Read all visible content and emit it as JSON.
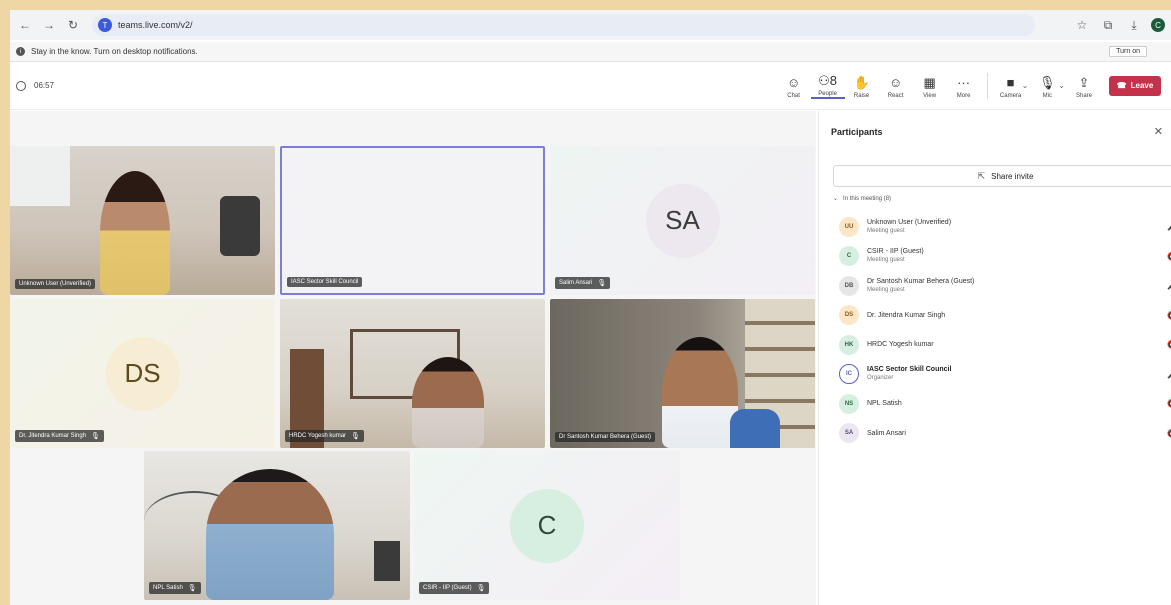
{
  "browser": {
    "url": "teams.live.com/v2/",
    "site_icon": "T",
    "profile": "C",
    "icons": [
      "back-icon",
      "forward-icon",
      "reload-icon",
      "star-icon",
      "extensions-icon",
      "download-icon"
    ]
  },
  "notification": {
    "text": "Stay in the know. Turn on desktop notifications.",
    "button": "Turn on"
  },
  "toolbar": {
    "timer": "06:57",
    "tools": [
      {
        "label": "Chat",
        "icon": "chat-icon",
        "glyph": "☺"
      },
      {
        "label": "People",
        "icon": "people-icon",
        "glyph": "⚇",
        "badge": "8"
      },
      {
        "label": "Raise",
        "icon": "raise-hand-icon",
        "glyph": "✋"
      },
      {
        "label": "React",
        "icon": "react-icon",
        "glyph": "☺"
      },
      {
        "label": "View",
        "icon": "view-icon",
        "glyph": "▦"
      },
      {
        "label": "More",
        "icon": "more-icon",
        "glyph": "···"
      },
      {
        "label": "Camera",
        "icon": "camera-icon",
        "glyph": "■"
      },
      {
        "label": "Mic",
        "icon": "mic-icon",
        "glyph": "🎙"
      },
      {
        "label": "Share",
        "icon": "share-icon",
        "glyph": "⇪"
      }
    ],
    "leave": "Leave"
  },
  "tiles": [
    {
      "name": "Unknown User (Unverified)",
      "type": "video",
      "muted": false
    },
    {
      "name": "IASC Sector Skill Council",
      "type": "blank",
      "muted": false
    },
    {
      "name": "Salim Ansari",
      "type": "avatar",
      "initials": "SA",
      "avatar_bg": "#ede7f0",
      "avatar_fg": "#3b3b3b",
      "muted": true
    },
    {
      "name": "Dr. Jitendra Kumar Singh",
      "type": "avatar",
      "initials": "DS",
      "avatar_bg": "#f7ecd4",
      "avatar_fg": "#5e4a1c",
      "muted": true
    },
    {
      "name": "HRDC Yogesh kumar",
      "type": "video",
      "muted": true
    },
    {
      "name": "Dr Santosh Kumar Behera (Guest)",
      "type": "video",
      "muted": false
    },
    {
      "name": "NPL Satish",
      "type": "video",
      "muted": true
    },
    {
      "name": "CSIR - IIP (Guest)",
      "type": "avatar",
      "initials": "C",
      "avatar_bg": "#d6efe0",
      "avatar_fg": "#2f4a3a",
      "muted": true
    }
  ],
  "panel": {
    "title": "Participants",
    "share_invite": "Share invite",
    "section": "In this meeting (8)",
    "participants": [
      {
        "initials": "UU",
        "name": "Unknown User (Unverified)",
        "role": "Meeting guest",
        "bg": "#fbe6c8",
        "fg": "#8a5a18",
        "mic": "🎤",
        "bold": false,
        "organizer": false
      },
      {
        "initials": "C",
        "name": "CSIR - IIP (Guest)",
        "role": "Meeting guest",
        "bg": "#d6efe0",
        "fg": "#2f6a45",
        "mic": "🔇",
        "bold": false,
        "organizer": false
      },
      {
        "initials": "DB",
        "name": "Dr Santosh Kumar Behera (Guest)",
        "role": "Meeting guest",
        "bg": "#e6e6e6",
        "fg": "#555555",
        "mic": "🎤",
        "bold": false,
        "organizer": false
      },
      {
        "initials": "DS",
        "name": "Dr. Jitendra Kumar Singh",
        "role": "",
        "bg": "#fbe6c8",
        "fg": "#8a5a18",
        "mic": "🔇",
        "bold": false,
        "organizer": false
      },
      {
        "initials": "HK",
        "name": "HRDC Yogesh kumar",
        "role": "",
        "bg": "#d6efe0",
        "fg": "#2f6a45",
        "mic": "🔇",
        "bold": false,
        "organizer": false
      },
      {
        "initials": "IC",
        "name": "IASC Sector Skill Council",
        "role": "Organizer",
        "bg": "#ffffff",
        "fg": "#5b5fc7",
        "mic": "🎤",
        "bold": true,
        "organizer": true
      },
      {
        "initials": "NS",
        "name": "NPL Satish",
        "role": "",
        "bg": "#d6efe0",
        "fg": "#2f6a45",
        "mic": "🔇",
        "bold": false,
        "organizer": false
      },
      {
        "initials": "SA",
        "name": "Salim Ansari",
        "role": "",
        "bg": "#ebe6f2",
        "fg": "#5a4a7a",
        "mic": "🔇",
        "bold": false,
        "organizer": false
      }
    ]
  },
  "colors": {
    "accent": "#5b5fc7",
    "leave": "#c4314b",
    "outer_background": "#eed7a4"
  }
}
